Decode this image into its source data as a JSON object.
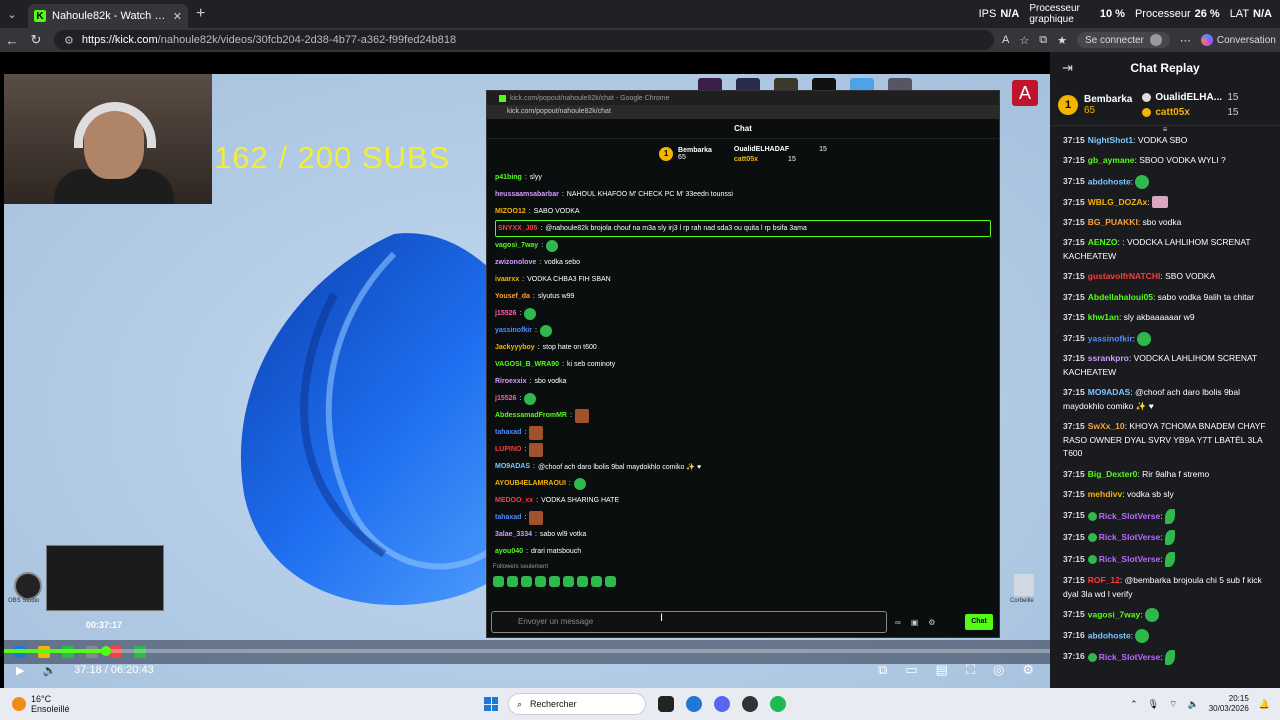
{
  "browser": {
    "tab_title": "Nahoule82k - Watch the VOD on Kick",
    "tab_close": "✕",
    "new_tab": "+",
    "tab_dropdown": "⌄",
    "url_host": "https://kick.com",
    "url_path": "/nahoule82k/videos/30fcb204-2d38-4b77-a362-f99fed24b818",
    "sign_in": "Se connecter",
    "conversation": "Conversation"
  },
  "system_stats": {
    "ips_label": "IPS",
    "ips_value": "N/A",
    "gpu_label_1": "Processeur",
    "gpu_label_2": "graphique",
    "gpu_value": "10 %",
    "cpu_label": "Processeur",
    "cpu_value": "26 %",
    "lat_label": "LAT",
    "lat_value": "N/A"
  },
  "video": {
    "overlay_text": "162 / 200  SUBS",
    "current_time": "37:18",
    "duration": "06:20:43",
    "time_separator": "/",
    "progress": 0.0979,
    "thumbnail_time": "00:37:17",
    "obs_label": "OBS Studio",
    "recycle_label": "Corbeille",
    "red_icon_letter": "A"
  },
  "popup": {
    "window_title": "kick.com/popout/nahoule82k/chat - Google Chrome",
    "url": "kick.com/popout/nahoule82k/chat",
    "chat_title": "Chat",
    "top_gifter_1": {
      "rank": "1",
      "name": "Bembarka",
      "amount": "65"
    },
    "top_gifter_2": {
      "name": "OualidELHADAF",
      "amount": "15"
    },
    "top_gifter_3": {
      "name": "catt05x",
      "amount": "15"
    },
    "followers_only": "Followers seulement",
    "input_placeholder": "Envoyer un message",
    "send_label": "Chat",
    "messages": [
      {
        "user": "p41bing",
        "text": "slyy",
        "color": "#53fc18"
      },
      {
        "user": "heussaamsabarbar",
        "text": "NAHOUL KHAFOO M' CHECK PC M' 33eedn tounssi",
        "color": "#d39cff"
      },
      {
        "user": "MIZOO12",
        "text": "SABO VODKA",
        "color": "#f4b400"
      },
      {
        "user": "SNYXX_J05",
        "text": "@nahoule82k brojola chouf na m3a sly irj3 l rp rah nad sda3 ou quita l rp bsifa 3ama",
        "color": "#ff3b3b"
      },
      {
        "user": "vagosi_7way",
        "text": "",
        "color": "#53fc18"
      },
      {
        "user": "zwizonolove",
        "text": "vodka sebo",
        "color": "#d39cff"
      },
      {
        "user": "ivaarxx",
        "text": "VODKA CHBA3 FIH SBAN",
        "color": "#f4b400"
      },
      {
        "user": "Yousef_da",
        "text": "slyutus w99",
        "color": "#ff9f3b"
      },
      {
        "user": "j15526",
        "text": "",
        "color": "#ff5fa8"
      },
      {
        "user": "yassinofkir",
        "text": "",
        "color": "#4f8cff"
      },
      {
        "user": "Jackyyyboy",
        "text": "stop hate on t600",
        "color": "#f4b400"
      },
      {
        "user": "VAGOSI_B_WRA90",
        "text": "ki seb cominoty",
        "color": "#53fc18"
      },
      {
        "user": "Riroexxix",
        "text": "sbo vodka",
        "color": "#d39cff"
      },
      {
        "user": "j15526",
        "text": "",
        "color": "#ff5fa8"
      },
      {
        "user": "AbdessamadFromMR",
        "text": "",
        "color": "#53fc18"
      },
      {
        "user": "tahaxad",
        "text": "",
        "color": "#4f8cff"
      },
      {
        "user": "LUPINO",
        "text": "",
        "color": "#ff3b3b"
      },
      {
        "user": "MO9ADAS",
        "text": "@choof ach daro lbolis 9bal maydokhlo comiko ✨ ♥",
        "color": "#7cc7ff"
      },
      {
        "user": "AYOUB4ELAMRAOUI",
        "text": "",
        "color": "#f4b400"
      },
      {
        "user": "MEDOO_xx",
        "text": "VODKA SHARING HATE",
        "color": "#ff3b3b"
      },
      {
        "user": "tahaxad",
        "text": "",
        "color": "#4f8cff"
      },
      {
        "user": "3alae_3334",
        "text": "sabo wl9 votka",
        "color": "#d39cff"
      },
      {
        "user": "ayou040",
        "text": "drari matsbouch",
        "color": "#53fc18"
      }
    ]
  },
  "side": {
    "title": "Chat Replay",
    "top1": {
      "rank": "1",
      "name": "Bembarka",
      "amount": "65"
    },
    "top2": {
      "name": "OualidELHA...",
      "amount": "15"
    },
    "top3": {
      "name": "catt05x",
      "amount": "15"
    },
    "messages": [
      {
        "time": "37:15",
        "user": "NightShot1",
        "text": "VODKA SBO",
        "color": "#7cc7ff",
        "emote": ""
      },
      {
        "time": "37:15",
        "user": "gb_aymane",
        "text": "SBOO VODKA WYLI ?",
        "color": "#53fc18",
        "emote": ""
      },
      {
        "time": "37:15",
        "user": "abdohoste",
        "text": "",
        "color": "#7cc7ff",
        "emote": "green"
      },
      {
        "time": "37:15",
        "user": "WBLG_DOZAx",
        "text": "",
        "color": "#f4b400",
        "emote": "pink"
      },
      {
        "time": "37:15",
        "user": "BG_PUAKKI",
        "text": "sbo vodka",
        "color": "#ff9f3b",
        "emote": ""
      },
      {
        "time": "37:15",
        "user": "AENZO",
        "text": ": VODCKA LAHLIHOM SCRENAT KACHEATEW",
        "color": "#53fc18",
        "emote": ""
      },
      {
        "time": "37:15",
        "user": "gustavoIfrNATCHI",
        "text": "SBO VODKA",
        "color": "#ff3b3b",
        "emote": ""
      },
      {
        "time": "37:15",
        "user": "Abdellahaloui05",
        "text": "sabo vodka 9alih ta chitar",
        "color": "#53fc18",
        "emote": ""
      },
      {
        "time": "37:15",
        "user": "khw1an",
        "text": "sly akbaaaaaar w9",
        "color": "#53fc18",
        "emote": ""
      },
      {
        "time": "37:15",
        "user": "yassinofkir",
        "text": "",
        "color": "#4f8cff",
        "emote": "green"
      },
      {
        "time": "37:15",
        "user": "ssrankpro",
        "text": "VODCKA LAHLIHOM SCRENAT KACHEATEW",
        "color": "#d39cff",
        "emote": ""
      },
      {
        "time": "37:15",
        "user": "MO9ADAS",
        "text": "@choof ach daro lbolis 9bal maydokhlo comiko ✨ ♥",
        "color": "#7cc7ff",
        "emote": ""
      },
      {
        "time": "37:15",
        "user": "SwXx_10",
        "text": "KHOYA 7CHOMA BNADEM CHAYF RASO OWNER DYAL SVRV YB9A Y7T LBATÉL 3LA T600",
        "color": "#ff9f3b",
        "emote": ""
      },
      {
        "time": "37:15",
        "user": "Big_Dexter0",
        "text": "Rir 9alha f stremo",
        "color": "#53fc18",
        "emote": ""
      },
      {
        "time": "37:15",
        "user": "mehdivv",
        "text": "vodka sb sly",
        "color": "#f4b400",
        "emote": ""
      },
      {
        "time": "37:15",
        "user": "Rick_SlotVerse",
        "text": "",
        "color": "#b86bff",
        "emote": "leaf"
      },
      {
        "time": "37:15",
        "user": "Rick_SlotVerse",
        "text": "",
        "color": "#b86bff",
        "emote": "leaf"
      },
      {
        "time": "37:15",
        "user": "Rick_SlotVerse",
        "text": "",
        "color": "#b86bff",
        "emote": "leaf"
      },
      {
        "time": "37:15",
        "user": "ROF_12",
        "text": "@bembarka brojoula chi 5 sub f kick dyal 3la wd l verify",
        "color": "#ff3b3b",
        "emote": ""
      },
      {
        "time": "37:15",
        "user": "vagosi_7way",
        "text": "",
        "color": "#53fc18",
        "emote": "green"
      },
      {
        "time": "37:16",
        "user": "abdohoste",
        "text": "",
        "color": "#7cc7ff",
        "emote": "green"
      },
      {
        "time": "37:16",
        "user": "Rick_SlotVerse",
        "text": "",
        "color": "#b86bff",
        "emote": "leaf"
      }
    ]
  },
  "taskbar": {
    "temp": "16°C",
    "weather": "Ensoleillé",
    "search": "Rechercher",
    "time": "20:15",
    "date": "30/03/2026"
  }
}
